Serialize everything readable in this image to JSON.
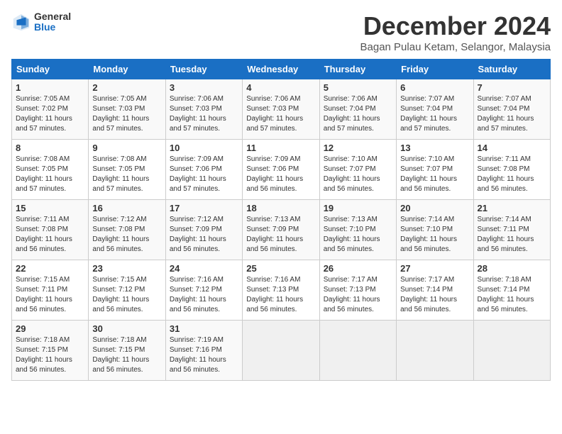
{
  "header": {
    "logo_general": "General",
    "logo_blue": "Blue",
    "title": "December 2024",
    "location": "Bagan Pulau Ketam, Selangor, Malaysia"
  },
  "weekdays": [
    "Sunday",
    "Monday",
    "Tuesday",
    "Wednesday",
    "Thursday",
    "Friday",
    "Saturday"
  ],
  "weeks": [
    [
      {
        "day": "1",
        "sunrise": "7:05 AM",
        "sunset": "7:02 PM",
        "daylight": "11 hours and 57 minutes."
      },
      {
        "day": "2",
        "sunrise": "7:05 AM",
        "sunset": "7:03 PM",
        "daylight": "11 hours and 57 minutes."
      },
      {
        "day": "3",
        "sunrise": "7:06 AM",
        "sunset": "7:03 PM",
        "daylight": "11 hours and 57 minutes."
      },
      {
        "day": "4",
        "sunrise": "7:06 AM",
        "sunset": "7:03 PM",
        "daylight": "11 hours and 57 minutes."
      },
      {
        "day": "5",
        "sunrise": "7:06 AM",
        "sunset": "7:04 PM",
        "daylight": "11 hours and 57 minutes."
      },
      {
        "day": "6",
        "sunrise": "7:07 AM",
        "sunset": "7:04 PM",
        "daylight": "11 hours and 57 minutes."
      },
      {
        "day": "7",
        "sunrise": "7:07 AM",
        "sunset": "7:04 PM",
        "daylight": "11 hours and 57 minutes."
      }
    ],
    [
      {
        "day": "8",
        "sunrise": "7:08 AM",
        "sunset": "7:05 PM",
        "daylight": "11 hours and 57 minutes."
      },
      {
        "day": "9",
        "sunrise": "7:08 AM",
        "sunset": "7:05 PM",
        "daylight": "11 hours and 57 minutes."
      },
      {
        "day": "10",
        "sunrise": "7:09 AM",
        "sunset": "7:06 PM",
        "daylight": "11 hours and 57 minutes."
      },
      {
        "day": "11",
        "sunrise": "7:09 AM",
        "sunset": "7:06 PM",
        "daylight": "11 hours and 56 minutes."
      },
      {
        "day": "12",
        "sunrise": "7:10 AM",
        "sunset": "7:07 PM",
        "daylight": "11 hours and 56 minutes."
      },
      {
        "day": "13",
        "sunrise": "7:10 AM",
        "sunset": "7:07 PM",
        "daylight": "11 hours and 56 minutes."
      },
      {
        "day": "14",
        "sunrise": "7:11 AM",
        "sunset": "7:08 PM",
        "daylight": "11 hours and 56 minutes."
      }
    ],
    [
      {
        "day": "15",
        "sunrise": "7:11 AM",
        "sunset": "7:08 PM",
        "daylight": "11 hours and 56 minutes."
      },
      {
        "day": "16",
        "sunrise": "7:12 AM",
        "sunset": "7:08 PM",
        "daylight": "11 hours and 56 minutes."
      },
      {
        "day": "17",
        "sunrise": "7:12 AM",
        "sunset": "7:09 PM",
        "daylight": "11 hours and 56 minutes."
      },
      {
        "day": "18",
        "sunrise": "7:13 AM",
        "sunset": "7:09 PM",
        "daylight": "11 hours and 56 minutes."
      },
      {
        "day": "19",
        "sunrise": "7:13 AM",
        "sunset": "7:10 PM",
        "daylight": "11 hours and 56 minutes."
      },
      {
        "day": "20",
        "sunrise": "7:14 AM",
        "sunset": "7:10 PM",
        "daylight": "11 hours and 56 minutes."
      },
      {
        "day": "21",
        "sunrise": "7:14 AM",
        "sunset": "7:11 PM",
        "daylight": "11 hours and 56 minutes."
      }
    ],
    [
      {
        "day": "22",
        "sunrise": "7:15 AM",
        "sunset": "7:11 PM",
        "daylight": "11 hours and 56 minutes."
      },
      {
        "day": "23",
        "sunrise": "7:15 AM",
        "sunset": "7:12 PM",
        "daylight": "11 hours and 56 minutes."
      },
      {
        "day": "24",
        "sunrise": "7:16 AM",
        "sunset": "7:12 PM",
        "daylight": "11 hours and 56 minutes."
      },
      {
        "day": "25",
        "sunrise": "7:16 AM",
        "sunset": "7:13 PM",
        "daylight": "11 hours and 56 minutes."
      },
      {
        "day": "26",
        "sunrise": "7:17 AM",
        "sunset": "7:13 PM",
        "daylight": "11 hours and 56 minutes."
      },
      {
        "day": "27",
        "sunrise": "7:17 AM",
        "sunset": "7:14 PM",
        "daylight": "11 hours and 56 minutes."
      },
      {
        "day": "28",
        "sunrise": "7:18 AM",
        "sunset": "7:14 PM",
        "daylight": "11 hours and 56 minutes."
      }
    ],
    [
      {
        "day": "29",
        "sunrise": "7:18 AM",
        "sunset": "7:15 PM",
        "daylight": "11 hours and 56 minutes."
      },
      {
        "day": "30",
        "sunrise": "7:18 AM",
        "sunset": "7:15 PM",
        "daylight": "11 hours and 56 minutes."
      },
      {
        "day": "31",
        "sunrise": "7:19 AM",
        "sunset": "7:16 PM",
        "daylight": "11 hours and 56 minutes."
      },
      null,
      null,
      null,
      null
    ]
  ],
  "labels": {
    "sunrise": "Sunrise:",
    "sunset": "Sunset:",
    "daylight": "Daylight:"
  }
}
